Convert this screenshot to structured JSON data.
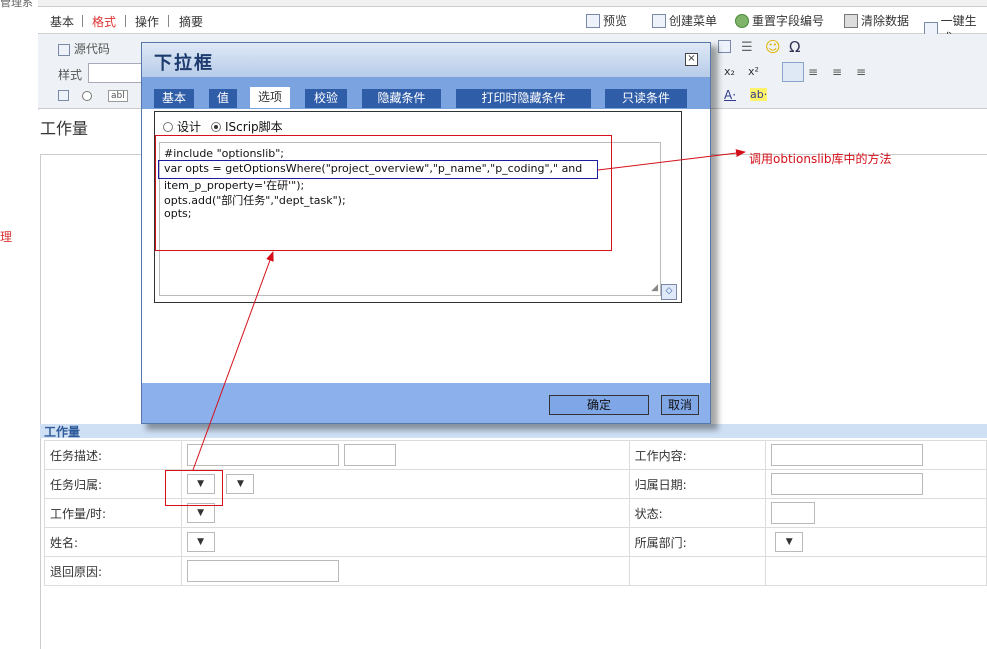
{
  "left_strip": {
    "top_text": "管理系",
    "side_text": "理"
  },
  "menu": {
    "tabs": [
      "基本",
      "格式",
      "操作",
      "摘要"
    ],
    "active_tab": "格式",
    "actions": [
      {
        "label": "预览",
        "icon": "preview-icon"
      },
      {
        "label": "创建菜单",
        "icon": "create-menu-icon"
      },
      {
        "label": "重置字段编号",
        "icon": "reset-icon"
      },
      {
        "label": "清除数据",
        "icon": "trash-icon"
      },
      {
        "label": "一键生成",
        "icon": "generate-icon"
      }
    ]
  },
  "toolbar": {
    "source_label": "源代码",
    "style_label": "样式"
  },
  "editor": {
    "title": "工作量",
    "section_label": "工作量",
    "form": {
      "task_desc": "任务描述:",
      "task_belong": "任务归属:",
      "work_hours": "工作量/时:",
      "name": "姓名:",
      "reject_reason": "退回原因:",
      "work_content": "工作内容:",
      "belong_date": "归属日期:",
      "status": "状态:",
      "department": "所属部门:",
      "select_glyph": "▼"
    }
  },
  "dialog": {
    "title": "下拉框",
    "close_glyph": "☒",
    "tabs": [
      "基本",
      "值",
      "选项",
      "校验",
      "隐藏条件",
      "打印时隐藏条件",
      "只读条件"
    ],
    "active_tab": "选项",
    "radio_design": "设计",
    "radio_script": "IScrip脚本",
    "script_selected": true,
    "code_lines": [
      "#include \"optionslib\";",
      "var opts = getOptionsWhere(\"project_overview\",\"p_name\",\"p_coding\",\" and",
      "item_p_property='在研'\");",
      "opts.add(\"部门任务\",\"dept_task\");",
      "opts;"
    ],
    "ok_label": "确定",
    "cancel_label": "取消"
  },
  "annotation": {
    "text": "调用obtionslib库中的方法",
    "color": "#d4101a"
  }
}
